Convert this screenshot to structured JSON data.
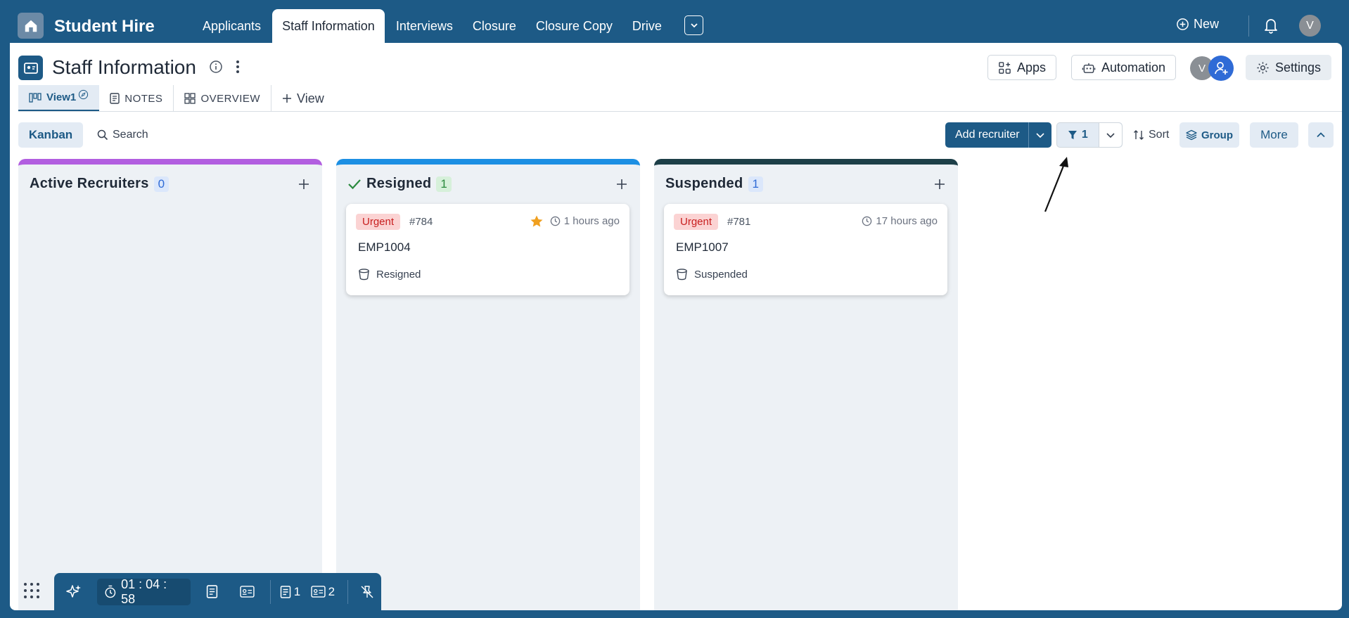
{
  "app": {
    "title": "Student Hire"
  },
  "nav": {
    "tabs": [
      {
        "label": "Applicants"
      },
      {
        "label": "Staff Information"
      },
      {
        "label": "Interviews"
      },
      {
        "label": "Closure"
      },
      {
        "label": "Closure Copy"
      },
      {
        "label": "Drive"
      }
    ],
    "active_index": 1
  },
  "topbar": {
    "new_label": "New",
    "avatar_initial": "V"
  },
  "page": {
    "title": "Staff Information",
    "buttons": {
      "apps": "Apps",
      "automation": "Automation",
      "settings": "Settings"
    },
    "collaborator_initial": "V"
  },
  "views": {
    "tabs": [
      {
        "label": "View1"
      },
      {
        "label": "NOTES"
      },
      {
        "label": "OVERVIEW"
      }
    ],
    "add_label": "View"
  },
  "toolbar": {
    "kanban": "Kanban",
    "search": "Search",
    "add_recruiter": "Add recruiter",
    "filter_count": "1",
    "sort": "Sort",
    "group": "Group",
    "more": "More"
  },
  "columns": [
    {
      "title": "Active Recruiters",
      "count": "0",
      "accent": "#b25ee0",
      "badge_bg": "#dbe7fb",
      "badge_fg": "#2f6bd6",
      "cards": []
    },
    {
      "title": "Resigned",
      "count": "1",
      "accent": "#1c8fe3",
      "badge_bg": "#d6f0da",
      "badge_fg": "#2b8a3e",
      "check": true,
      "cards": [
        {
          "priority": "Urgent",
          "number": "#784",
          "time": "1 hours ago",
          "starred": true,
          "title": "EMP1004",
          "status": "Resigned"
        }
      ]
    },
    {
      "title": "Suspended",
      "count": "1",
      "accent": "#1d3f48",
      "badge_bg": "#dbe7fb",
      "badge_fg": "#2f6bd6",
      "cards": [
        {
          "priority": "Urgent",
          "number": "#781",
          "time": "17 hours ago",
          "starred": false,
          "title": "EMP1007",
          "status": "Suspended"
        }
      ]
    }
  ],
  "dock": {
    "timer": "01 : 04 : 58",
    "notes_count": "1",
    "cards_count": "2"
  }
}
